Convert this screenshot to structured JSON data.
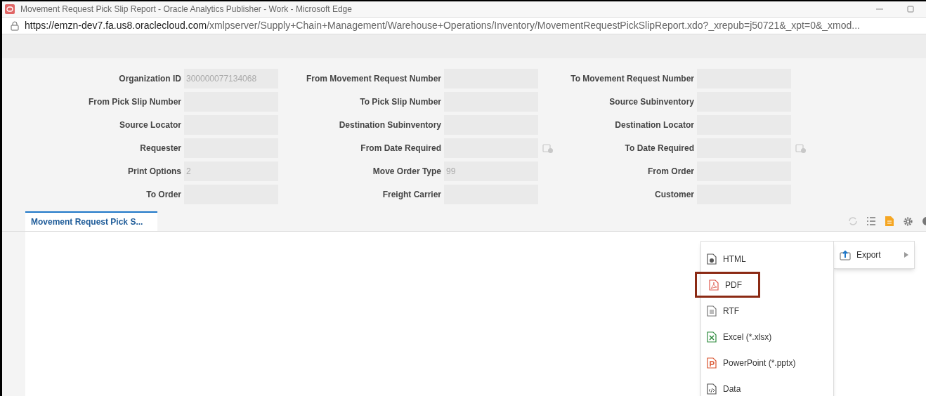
{
  "window": {
    "title": "Movement Request Pick Slip Report - Oracle Analytics Publisher - Work - Microsoft Edge"
  },
  "address_bar": {
    "url_host": "https://emzn-dev7.fa.us8.oraclecloud.com",
    "url_path": "/xmlpserver/Supply+Chain+Management/Warehouse+Operations/Inventory/MovementRequestPickSlipReport.xdo?_xrepub=j50721&_xpt=0&_xmod..."
  },
  "parameters": [
    [
      {
        "label": "Organization ID",
        "value": "300000077134068",
        "kind": "text"
      },
      {
        "label": "From Movement Request Number",
        "kind": "text"
      },
      {
        "label": "To Movement Request Number",
        "kind": "text"
      }
    ],
    [
      {
        "label": "From Pick Slip Number",
        "kind": "text"
      },
      {
        "label": "To Pick Slip Number",
        "kind": "text"
      },
      {
        "label": "Source Subinventory",
        "kind": "text"
      }
    ],
    [
      {
        "label": "Source Locator",
        "kind": "text"
      },
      {
        "label": "Destination Subinventory",
        "kind": "text"
      },
      {
        "label": "Destination Locator",
        "kind": "text"
      }
    ],
    [
      {
        "label": "Requester",
        "kind": "text"
      },
      {
        "label": "From Date Required",
        "kind": "date"
      },
      {
        "label": "To Date Required",
        "kind": "date"
      }
    ],
    [
      {
        "label": "Print Options",
        "value": "2",
        "kind": "text"
      },
      {
        "label": "Move Order Type",
        "value": "99",
        "kind": "text"
      },
      {
        "label": "From Order",
        "kind": "text"
      }
    ],
    [
      {
        "label": "To Order",
        "kind": "text"
      },
      {
        "label": "Freight Carrier",
        "kind": "text"
      },
      {
        "label": "Customer",
        "kind": "text"
      }
    ]
  ],
  "tabs": [
    {
      "label": "Movement Request Pick S...",
      "selected": true
    }
  ],
  "actions_menu": {
    "items": [
      {
        "label": "Export"
      }
    ]
  },
  "export_menu": {
    "items": [
      {
        "label": "HTML",
        "kind": "html",
        "highlighted": false
      },
      {
        "label": "PDF",
        "kind": "pdf",
        "highlighted": true
      },
      {
        "label": "RTF",
        "kind": "rtf",
        "highlighted": false
      },
      {
        "label": "Excel (*.xlsx)",
        "kind": "excel",
        "highlighted": false
      },
      {
        "label": "PowerPoint (*.pptx)",
        "kind": "powerpoint",
        "highlighted": false
      },
      {
        "label": "Data",
        "kind": "data",
        "highlighted": false
      }
    ]
  }
}
